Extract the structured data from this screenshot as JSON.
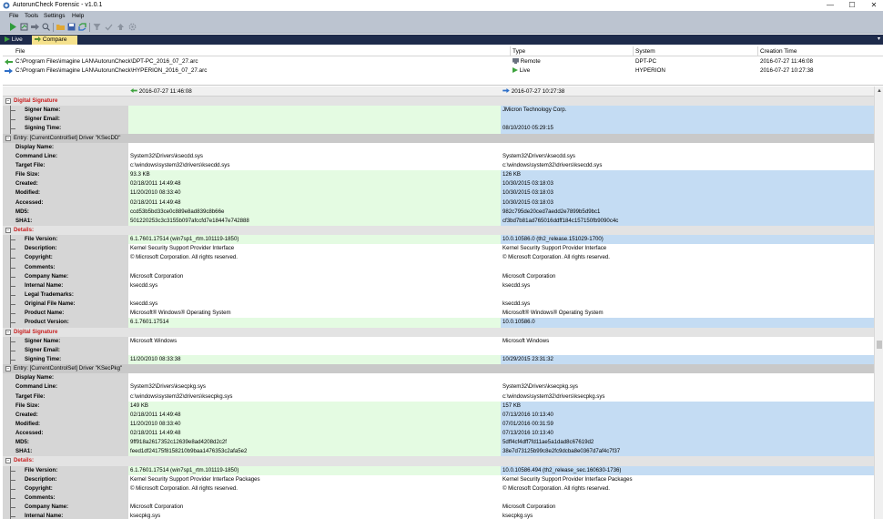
{
  "window": {
    "title": "AutorunCheck Forensic - v1.0.1",
    "minimize": "—",
    "maximize": "☐",
    "close": "✕"
  },
  "menu": [
    "File",
    "Tools",
    "Settings",
    "Help"
  ],
  "toolbar_icons": [
    "run-icon",
    "scan-icon",
    "compare-icon",
    "search-icon",
    "folder-icon",
    "save-icon",
    "refresh-icon",
    "filter-icon",
    "check-icon",
    "upload-icon",
    "settings-icon"
  ],
  "tabs": {
    "live": "Live",
    "compare": "Compare",
    "close": "✕",
    "menu": "▾"
  },
  "filelist": {
    "headers": {
      "file": "File",
      "type": "Type",
      "system": "System",
      "time": "Creation Time"
    },
    "rows": [
      {
        "file": "C:\\Program Files\\imagine LAN\\AutorunCheck\\DPT-PC_2016_07_27.arc",
        "type": "Remote",
        "system": "DPT-PC",
        "time": "2016-07-27 11:46:08",
        "arrow_color": "#3ea33e"
      },
      {
        "file": "C:\\Program Files\\imagine LAN\\AutorunCheck\\HYPERION_2016_07_27.arc",
        "type": "Live",
        "system": "HYPERION",
        "time": "2016-07-27 10:27:38",
        "arrow_color": "#2e6fc8"
      }
    ]
  },
  "compare": {
    "left_date": "2016-07-27 11:46:08",
    "right_date": "2016-07-27 10:27:38"
  },
  "rows": [
    {
      "kind": "section",
      "text": "Digital Signature",
      "toggle": "−"
    },
    {
      "kind": "field",
      "label": "Signer Name:",
      "indent": true,
      "left": "",
      "right": "JMicron Technology Corp.",
      "lbg": "green",
      "rbg": "blue"
    },
    {
      "kind": "field",
      "label": "Signer Email:",
      "indent": true,
      "left": "",
      "right": "",
      "lbg": "green",
      "rbg": "blue"
    },
    {
      "kind": "field",
      "label": "Signing Time:",
      "indent": true,
      "left": "",
      "right": "08/10/2010 05:29:15",
      "lbg": "green",
      "rbg": "blue"
    },
    {
      "kind": "entry",
      "text": "Entry: [CurrentControlSet] Driver \"KSecDD\"",
      "toggle": "−"
    },
    {
      "kind": "field",
      "label": "Display Name:",
      "indent": false,
      "left": "",
      "right": "",
      "lbg": "white",
      "rbg": "white"
    },
    {
      "kind": "field",
      "label": "Command Line:",
      "indent": false,
      "left": "System32\\Drivers\\ksecdd.sys",
      "right": "System32\\Drivers\\ksecdd.sys",
      "lbg": "white",
      "rbg": "white"
    },
    {
      "kind": "field",
      "label": "Target File:",
      "indent": false,
      "left": "c:\\windows\\system32\\drivers\\ksecdd.sys",
      "right": "c:\\windows\\system32\\drivers\\ksecdd.sys",
      "lbg": "white",
      "rbg": "white"
    },
    {
      "kind": "field",
      "label": "File Size:",
      "indent": false,
      "left": "93.3 KB",
      "right": "126 KB",
      "lbg": "green",
      "rbg": "blue"
    },
    {
      "kind": "field",
      "label": "Created:",
      "indent": false,
      "left": "02/18/2011 14:49:48",
      "right": "10/30/2015 03:18:03",
      "lbg": "green",
      "rbg": "blue"
    },
    {
      "kind": "field",
      "label": "Modified:",
      "indent": false,
      "left": "11/20/2010 08:33:40",
      "right": "10/30/2015 03:18:03",
      "lbg": "green",
      "rbg": "blue"
    },
    {
      "kind": "field",
      "label": "Accessed:",
      "indent": false,
      "left": "02/18/2011 14:49:48",
      "right": "10/30/2015 03:18:03",
      "lbg": "green",
      "rbg": "blue"
    },
    {
      "kind": "field",
      "label": "MD5:",
      "indent": false,
      "left": "ccd53b5bd33ce0c889e8ad839c8b66e",
      "right": "982c795de20ced7aedd2e7899b5d9bc1",
      "lbg": "green",
      "rbg": "blue"
    },
    {
      "kind": "field",
      "label": "SHA1:",
      "indent": false,
      "left": "501220253c3c3155b097afccfd7e18447e742888",
      "right": "cf3bd7b81ad765016ddff184c157150fb9090c4c",
      "lbg": "green",
      "rbg": "blue"
    },
    {
      "kind": "section",
      "text": "Details:",
      "toggle": "−"
    },
    {
      "kind": "field",
      "label": "File Version:",
      "indent": true,
      "left": "6.1.7601.17514 (win7sp1_rtm.101119-1850)",
      "right": "10.0.10586.0 (th2_release.151029-1700)",
      "lbg": "green",
      "rbg": "blue"
    },
    {
      "kind": "field",
      "label": "Description:",
      "indent": true,
      "left": "Kernel Security Support Provider Interface",
      "right": "Kernel Security Support Provider Interface",
      "lbg": "white",
      "rbg": "white"
    },
    {
      "kind": "field",
      "label": "Copyright:",
      "indent": true,
      "left": "© Microsoft Corporation. All rights reserved.",
      "right": "© Microsoft Corporation. All rights reserved.",
      "lbg": "white",
      "rbg": "white"
    },
    {
      "kind": "field",
      "label": "Comments:",
      "indent": true,
      "left": "",
      "right": "",
      "lbg": "white",
      "rbg": "white"
    },
    {
      "kind": "field",
      "label": "Company Name:",
      "indent": true,
      "left": "Microsoft Corporation",
      "right": "Microsoft Corporation",
      "lbg": "white",
      "rbg": "white"
    },
    {
      "kind": "field",
      "label": "Internal Name:",
      "indent": true,
      "left": "ksecdd.sys",
      "right": "ksecdd.sys",
      "lbg": "white",
      "rbg": "white"
    },
    {
      "kind": "field",
      "label": "Legal Trademarks:",
      "indent": true,
      "left": "",
      "right": "",
      "lbg": "white",
      "rbg": "white"
    },
    {
      "kind": "field",
      "label": "Original File Name:",
      "indent": true,
      "left": "ksecdd.sys",
      "right": "ksecdd.sys",
      "lbg": "white",
      "rbg": "white"
    },
    {
      "kind": "field",
      "label": "Product Name:",
      "indent": true,
      "left": "Microsoft® Windows® Operating System",
      "right": "Microsoft® Windows® Operating System",
      "lbg": "white",
      "rbg": "white"
    },
    {
      "kind": "field",
      "label": "Product Version:",
      "indent": true,
      "left": "6.1.7601.17514",
      "right": "10.0.10586.0",
      "lbg": "green",
      "rbg": "blue"
    },
    {
      "kind": "section",
      "text": "Digital Signature",
      "toggle": "−"
    },
    {
      "kind": "field",
      "label": "Signer Name:",
      "indent": true,
      "left": "Microsoft Windows",
      "right": "Microsoft Windows",
      "lbg": "white",
      "rbg": "white"
    },
    {
      "kind": "field",
      "label": "Signer Email:",
      "indent": true,
      "left": "",
      "right": "",
      "lbg": "white",
      "rbg": "white"
    },
    {
      "kind": "field",
      "label": "Signing Time:",
      "indent": true,
      "left": "11/20/2010 08:33:38",
      "right": "10/29/2015 23:31:32",
      "lbg": "green",
      "rbg": "blue"
    },
    {
      "kind": "entry",
      "text": "Entry: [CurrentControlSet] Driver \"KSecPkg\"",
      "toggle": "−"
    },
    {
      "kind": "field",
      "label": "Display Name:",
      "indent": false,
      "left": "",
      "right": "",
      "lbg": "white",
      "rbg": "white"
    },
    {
      "kind": "field",
      "label": "Command Line:",
      "indent": false,
      "left": "System32\\Drivers\\ksecpkg.sys",
      "right": "System32\\Drivers\\ksecpkg.sys",
      "lbg": "white",
      "rbg": "white"
    },
    {
      "kind": "field",
      "label": "Target File:",
      "indent": false,
      "left": "c:\\windows\\system32\\drivers\\ksecpkg.sys",
      "right": "c:\\windows\\system32\\drivers\\ksecpkg.sys",
      "lbg": "white",
      "rbg": "white"
    },
    {
      "kind": "field",
      "label": "File Size:",
      "indent": false,
      "left": "149 KB",
      "right": "157 KB",
      "lbg": "green",
      "rbg": "blue"
    },
    {
      "kind": "field",
      "label": "Created:",
      "indent": false,
      "left": "02/18/2011 14:49:48",
      "right": "07/13/2016 10:13:40",
      "lbg": "green",
      "rbg": "blue"
    },
    {
      "kind": "field",
      "label": "Modified:",
      "indent": false,
      "left": "11/20/2010 08:33:40",
      "right": "07/01/2016 00:31:59",
      "lbg": "green",
      "rbg": "blue"
    },
    {
      "kind": "field",
      "label": "Accessed:",
      "indent": false,
      "left": "02/18/2011 14:49:48",
      "right": "07/13/2016 10:13:40",
      "lbg": "green",
      "rbg": "blue"
    },
    {
      "kind": "field",
      "label": "MD5:",
      "indent": false,
      "left": "9ff918a2617352c12639e8ad4208d2c2f",
      "right": "5dff4cf4dff7fd11ae5a1dad8c67619d2",
      "lbg": "green",
      "rbg": "blue"
    },
    {
      "kind": "field",
      "label": "SHA1:",
      "indent": false,
      "left": "feed1df24175f8158210b9baa1476353c2afa5e2",
      "right": "38e7d73125b99c8e2fc9dcba8e0367d7af4c7f37",
      "lbg": "green",
      "rbg": "blue"
    },
    {
      "kind": "section",
      "text": "Details:",
      "toggle": "−"
    },
    {
      "kind": "field",
      "label": "File Version:",
      "indent": true,
      "left": "6.1.7601.17514 (win7sp1_rtm.101119-1850)",
      "right": "10.0.10586.494 (th2_release_sec.160630-1736)",
      "lbg": "green",
      "rbg": "blue"
    },
    {
      "kind": "field",
      "label": "Description:",
      "indent": true,
      "left": "Kernel Security Support Provider Interface Packages",
      "right": "Kernel Security Support Provider Interface Packages",
      "lbg": "white",
      "rbg": "white"
    },
    {
      "kind": "field",
      "label": "Copyright:",
      "indent": true,
      "left": "© Microsoft Corporation. All rights reserved.",
      "right": "© Microsoft Corporation. All rights reserved.",
      "lbg": "white",
      "rbg": "white"
    },
    {
      "kind": "field",
      "label": "Comments:",
      "indent": true,
      "left": "",
      "right": "",
      "lbg": "white",
      "rbg": "white"
    },
    {
      "kind": "field",
      "label": "Company Name:",
      "indent": true,
      "left": "Microsoft Corporation",
      "right": "Microsoft Corporation",
      "lbg": "white",
      "rbg": "white"
    },
    {
      "kind": "field",
      "label": "Internal Name:",
      "indent": true,
      "left": "ksecpkg.sys",
      "right": "ksecpkg.sys",
      "lbg": "white",
      "rbg": "white"
    }
  ],
  "colors": {
    "green": "#e4fbe2",
    "blue": "#c4dcf3",
    "section_red": "#c81e1e"
  }
}
